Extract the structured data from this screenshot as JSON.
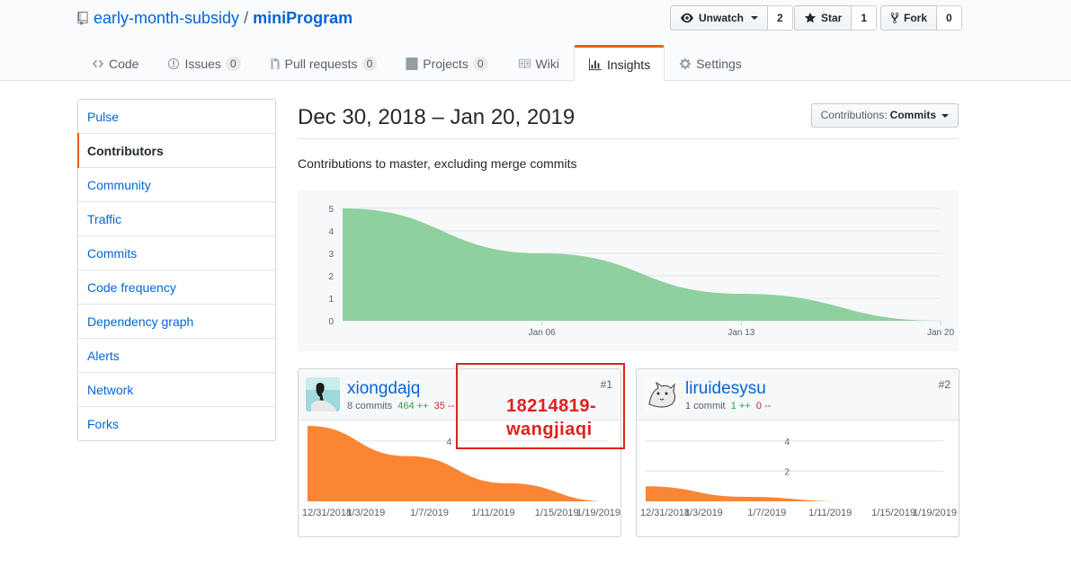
{
  "repo": {
    "owner": "early-month-subsidy",
    "separator": "/",
    "name": "miniProgram"
  },
  "actions": {
    "watch": {
      "label": "Unwatch",
      "count": "2"
    },
    "star": {
      "label": "Star",
      "count": "1"
    },
    "fork": {
      "label": "Fork",
      "count": "0"
    }
  },
  "nav": {
    "code": {
      "label": "Code"
    },
    "issues": {
      "label": "Issues",
      "count": "0"
    },
    "pulls": {
      "label": "Pull requests",
      "count": "0"
    },
    "projects": {
      "label": "Projects",
      "count": "0"
    },
    "wiki": {
      "label": "Wiki"
    },
    "insights": {
      "label": "Insights"
    },
    "settings": {
      "label": "Settings"
    }
  },
  "sidebar": {
    "items": [
      {
        "label": "Pulse"
      },
      {
        "label": "Contributors",
        "selected": true
      },
      {
        "label": "Community"
      },
      {
        "label": "Traffic"
      },
      {
        "label": "Commits"
      },
      {
        "label": "Code frequency"
      },
      {
        "label": "Dependency graph"
      },
      {
        "label": "Alerts"
      },
      {
        "label": "Network"
      },
      {
        "label": "Forks"
      }
    ]
  },
  "main": {
    "range_title": "Dec 30, 2018 – Jan 20, 2019",
    "contributions_select": {
      "prefix": "Contributions:",
      "value": "Commits"
    },
    "description": "Contributions to master, excluding merge commits"
  },
  "colors": {
    "main_area": "#8fd19e",
    "person_area": "#fb8532",
    "accent": "#e36209",
    "annotation": "#e02020"
  },
  "chart_data": [
    {
      "type": "area",
      "title": "",
      "x": [
        "Dec 30",
        "Jan 06",
        "Jan 13",
        "Jan 20"
      ],
      "x_tick_labels": [
        "Jan 06",
        "Jan 13",
        "Jan 20"
      ],
      "y": [
        5,
        3,
        1.2,
        0
      ],
      "y_ticks": [
        0,
        1,
        2,
        3,
        4,
        5
      ],
      "ylim": [
        0,
        5
      ],
      "grid": true,
      "series": [
        {
          "name": "",
          "values": [
            5,
            3,
            1.2,
            0
          ]
        }
      ]
    },
    {
      "type": "area",
      "x_tick_labels": [
        "12/31/2018",
        "1/3/2019",
        "1/7/2019",
        "1/11/2019",
        "1/15/2019",
        "1/19/2019"
      ],
      "y_ticks": [
        4
      ],
      "ylim": [
        0,
        5
      ],
      "grid": true,
      "series": [
        {
          "name": "",
          "values": [
            5,
            3,
            1.2,
            0
          ]
        }
      ]
    },
    {
      "type": "area",
      "x_tick_labels": [
        "12/31/2018",
        "1/3/2019",
        "1/7/2019",
        "1/11/2019",
        "1/15/2019",
        "1/19/2019"
      ],
      "y_ticks": [
        2,
        4
      ],
      "ylim": [
        0,
        5
      ],
      "grid": true,
      "series": [
        {
          "name": "",
          "values": [
            1,
            0.3,
            0,
            0
          ]
        }
      ]
    }
  ],
  "contributors": [
    {
      "username": "xiongdajq",
      "commits": "8 commits",
      "additions": "464 ++",
      "deletions": "35 --",
      "rank": "#1",
      "avatar_icon": "user-avatar-photo-icon"
    },
    {
      "username": "liruidesysu",
      "commits": "1 commit",
      "additions": "1 ++",
      "deletions": "0 --",
      "rank": "#2",
      "avatar_icon": "cat-sketch-avatar-icon"
    }
  ],
  "annotation": {
    "text_line1": "18214819-",
    "text_line2": "wangjiaqi"
  }
}
